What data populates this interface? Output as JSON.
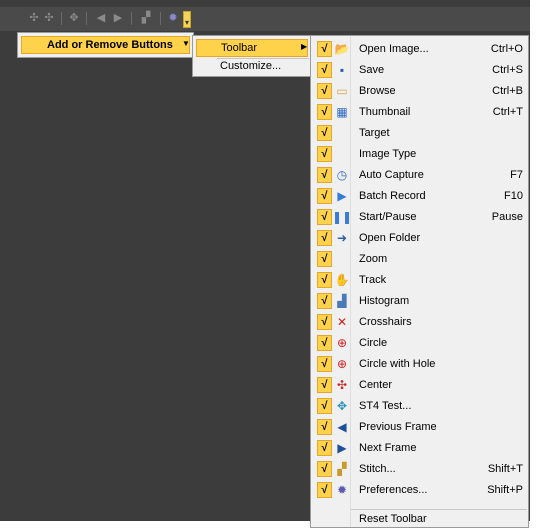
{
  "colors": {
    "highlight": "#ffd24c",
    "highlight_border": "#e4a72a",
    "menu_bg": "#f0f0f0",
    "workspace_bg": "#3c3c3c"
  },
  "toolbar_icons": [
    "crosshair-icon",
    "crosshair-icon",
    "move-icon",
    "previous-frame-icon",
    "next-frame-icon",
    "stitch-icon",
    "preferences-icon"
  ],
  "menu1": {
    "item_label": "Add or Remove Buttons",
    "arrow": "▼"
  },
  "menu2": {
    "toolbar_label": "Toolbar",
    "arrow": "▶",
    "customize_label": "Customize..."
  },
  "menu3": {
    "items": [
      {
        "label": "Open Image...",
        "shortcut": "Ctrl+O",
        "checked": true,
        "icon": "open-folder-icon",
        "glyph": "📂",
        "color": "#d9a520"
      },
      {
        "label": "Save",
        "shortcut": "Ctrl+S",
        "checked": true,
        "icon": "save-icon",
        "glyph": "▪",
        "color": "#2a5aa8"
      },
      {
        "label": "Browse",
        "shortcut": "Ctrl+B",
        "checked": true,
        "icon": "browse-icon",
        "glyph": "▭",
        "color": "#d8a64a"
      },
      {
        "label": "Thumbnail",
        "shortcut": "Ctrl+T",
        "checked": true,
        "icon": "thumbnail-icon",
        "glyph": "▦",
        "color": "#2f6cc0"
      },
      {
        "label": "Target",
        "shortcut": "",
        "checked": true,
        "icon": "",
        "glyph": "",
        "color": ""
      },
      {
        "label": "Image Type",
        "shortcut": "",
        "checked": true,
        "icon": "",
        "glyph": "",
        "color": ""
      },
      {
        "label": "Auto Capture",
        "shortcut": "F7",
        "checked": true,
        "icon": "clock-icon",
        "glyph": "◷",
        "color": "#2f6cc0"
      },
      {
        "label": "Batch Record",
        "shortcut": "F10",
        "checked": true,
        "icon": "play-icon",
        "glyph": "▶",
        "color": "#3a7bd5"
      },
      {
        "label": "Start/Pause",
        "shortcut": "Pause",
        "checked": true,
        "icon": "pause-icon",
        "glyph": "❚❚",
        "color": "#3a7bd5"
      },
      {
        "label": "Open Folder",
        "shortcut": "",
        "checked": true,
        "icon": "arrow-right-icon",
        "glyph": "➜",
        "color": "#2f5fa8"
      },
      {
        "label": "Zoom",
        "shortcut": "",
        "checked": true,
        "icon": "",
        "glyph": "",
        "color": ""
      },
      {
        "label": "Track",
        "shortcut": "",
        "checked": true,
        "icon": "hand-icon",
        "glyph": "✋",
        "color": "#333333"
      },
      {
        "label": "Histogram",
        "shortcut": "",
        "checked": true,
        "icon": "histogram-icon",
        "glyph": "▟",
        "color": "#4a7ab8"
      },
      {
        "label": "Crosshairs",
        "shortcut": "",
        "checked": true,
        "icon": "cross-icon",
        "glyph": "✕",
        "color": "#d42020"
      },
      {
        "label": "Circle",
        "shortcut": "",
        "checked": true,
        "icon": "circle-target-icon",
        "glyph": "⊕",
        "color": "#d42020"
      },
      {
        "label": "Circle with Hole",
        "shortcut": "",
        "checked": true,
        "icon": "circle-hole-target-icon",
        "glyph": "⊕",
        "color": "#d42020"
      },
      {
        "label": "Center",
        "shortcut": "",
        "checked": true,
        "icon": "center-icon",
        "glyph": "✣",
        "color": "#d42020"
      },
      {
        "label": "ST4 Test...",
        "shortcut": "",
        "checked": true,
        "icon": "st4-icon",
        "glyph": "✥",
        "color": "#2a8fb8"
      },
      {
        "label": "Previous Frame",
        "shortcut": "",
        "checked": true,
        "icon": "previous-frame-icon",
        "glyph": "◀",
        "color": "#1f4f9a"
      },
      {
        "label": "Next Frame",
        "shortcut": "",
        "checked": true,
        "icon": "next-frame-icon",
        "glyph": "▶",
        "color": "#1f4f9a"
      },
      {
        "label": "Stitch...",
        "shortcut": "Shift+T",
        "checked": true,
        "icon": "stitch-icon",
        "glyph": "▞",
        "color": "#c99a2a"
      },
      {
        "label": "Preferences...",
        "shortcut": "Shift+P",
        "checked": true,
        "icon": "gear-icon",
        "glyph": "✹",
        "color": "#5a5ab0"
      }
    ],
    "reset_label": "Reset Toolbar",
    "check_glyph": "√"
  }
}
